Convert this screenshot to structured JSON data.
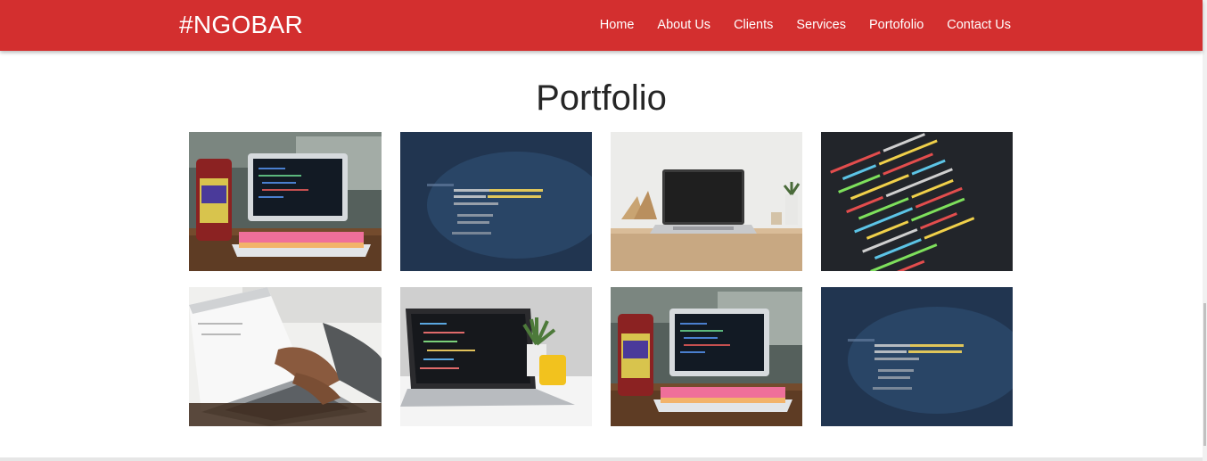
{
  "brand": "#NGOBAR",
  "nav": {
    "items": [
      {
        "label": "Home"
      },
      {
        "label": "About Us"
      },
      {
        "label": "Clients"
      },
      {
        "label": "Services"
      },
      {
        "label": "Portofolio"
      },
      {
        "label": "Contact Us"
      }
    ]
  },
  "portfolio": {
    "title": "Portfolio",
    "images": [
      {
        "subject": "laptop-on-desk-with-bottle"
      },
      {
        "subject": "blurred-code-screen-blue"
      },
      {
        "subject": "laptop-on-wooden-shelf"
      },
      {
        "subject": "colorful-code-screen-dark"
      },
      {
        "subject": "hands-typing-on-laptop"
      },
      {
        "subject": "laptop-with-plant-and-mug"
      },
      {
        "subject": "laptop-on-desk-with-bottle"
      },
      {
        "subject": "blurred-code-screen-blue"
      }
    ]
  },
  "colors": {
    "navbar": "#d32f2f",
    "nav_text": "#ffffff",
    "title_text": "#262626"
  }
}
